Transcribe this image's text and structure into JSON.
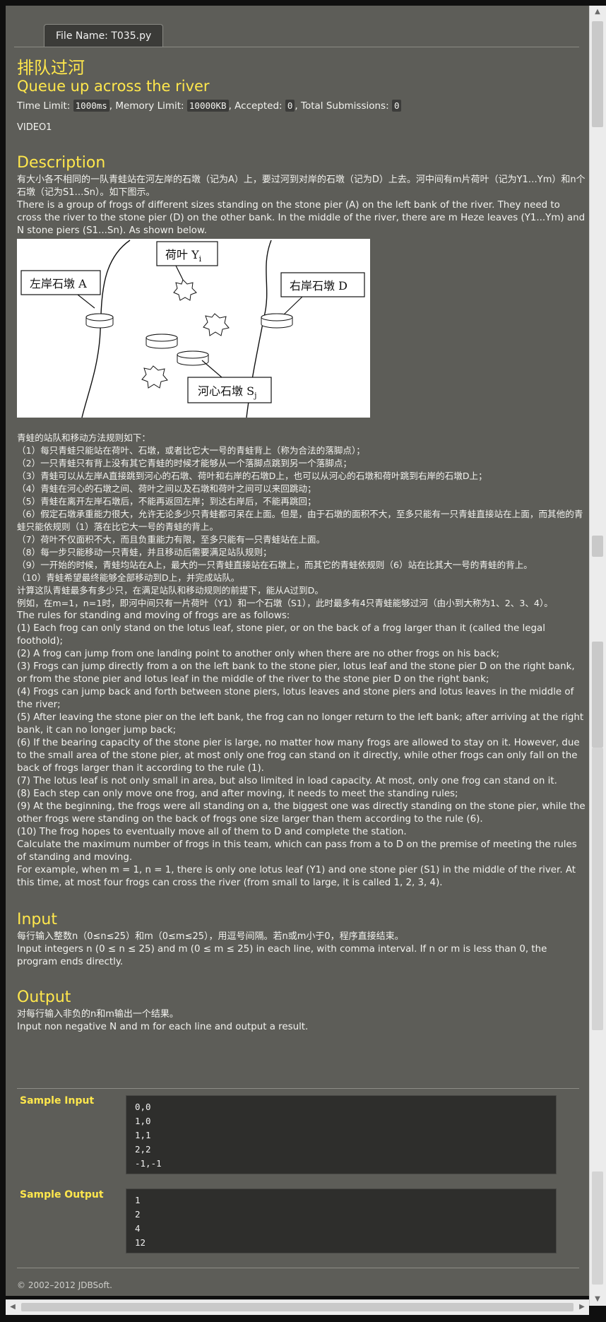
{
  "tab": {
    "file_name_label": "File Name: T035.py"
  },
  "problem": {
    "title_cn": "排队过河",
    "title_en": "Queue up across the river",
    "meta": {
      "time_limit_label": "Time Limit: ",
      "time_limit": "1000ms",
      "memory_limit_label": ", Memory Limit: ",
      "memory_limit": "10000KB",
      "accepted_label": ", Accepted: ",
      "accepted": "0",
      "total_submissions_label": ", Total Submissions: ",
      "total_submissions": "0"
    },
    "video": "VIDEO1"
  },
  "description": {
    "heading": "Description",
    "text_cn": "有大小各不相同的一队青蛙站在河左岸的石墩（记为A）上，要过河到对岸的石墩（记为D）上去。河中间有m片荷叶（记为Y1…Ym）和n个石墩（记为S1…Sn）。如下图示。",
    "text_en": "There is a group of frogs of different sizes standing on the stone pier (A) on the left bank of the river. They need to cross the river to the stone pier (D) on the other bank. In the middle of the river, there are m Heze leaves (Y1...Ym) and N stone piers (S1...Sn). As shown below.",
    "figure_labels": {
      "left_pier": "左岸石墩 A",
      "lotus": "荷叶 Y",
      "lotus_sub": "i",
      "right_pier": "右岸石墩 D",
      "middle_pier": "河心石墩 S",
      "middle_sub": "j"
    },
    "rules_cn": "青蛙的站队和移动方法规则如下：\n（1）每只青蛙只能站在荷叶、石墩，或者比它大一号的青蛙背上（称为合法的落脚点）；\n（2）一只青蛙只有背上没有其它青蛙的时候才能够从一个落脚点跳到另一个落脚点；\n（3）青蛙可以从左岸A直接跳到河心的石墩、荷叶和右岸的石墩D上，也可以从河心的石墩和荷叶跳到右岸的石墩D上；\n（4）青蛙在河心的石墩之间、荷叶之间以及石墩和荷叶之间可以来回跳动；\n（5）青蛙在离开左岸石墩后，不能再返回左岸；到达右岸后，不能再跳回；\n（6）假定石墩承重能力很大，允许无论多少只青蛙都可呆在上面。但是，由于石墩的面积不大，至多只能有一只青蛙直接站在上面，而其他的青蛙只能依规则（1）落在比它大一号的青蛙的背上。\n（7）荷叶不仅面积不大，而且负重能力有限，至多只能有一只青蛙站在上面。\n（8）每一步只能移动一只青蛙，并且移动后需要满足站队规则；\n（9）一开始的时候，青蛙均站在A上，最大的一只青蛙直接站在石墩上，而其它的青蛙依规则（6）站在比其大一号的青蛙的背上。\n（10）青蛙希望最终能够全部移动到D上，并完成站队。\n计算这队青蛙最多有多少只，在满足站队和移动规则的前提下，能从A过到D。\n例如，在m=1，n=1时，即河中间只有一片荷叶（Y1）和一个石墩（S1），此时最多有4只青蛙能够过河（由小到大称为1、2、3、4）。",
    "rules_en": "The rules for standing and moving of frogs are as follows:\n(1) Each frog can only stand on the lotus leaf, stone pier, or on the back of a frog larger than it (called the legal foothold);\n(2) A frog can jump from one landing point to another only when there are no other frogs on his back;\n(3) Frogs can jump directly from a on the left bank to the stone pier, lotus leaf and the stone pier D on the right bank, or from the stone pier and lotus leaf in the middle of the river to the stone pier D on the right bank;\n(4) Frogs can jump back and forth between stone piers, lotus leaves and stone piers and lotus leaves in the middle of the river;\n(5) After leaving the stone pier on the left bank, the frog can no longer return to the left bank; after arriving at the right bank, it can no longer jump back;\n(6) If the bearing capacity of the stone pier is large, no matter how many frogs are allowed to stay on it. However, due to the small area of the stone pier, at most only one frog can stand on it directly, while other frogs can only fall on the back of frogs larger than it according to the rule (1).\n(7) The lotus leaf is not only small in area, but also limited in load capacity. At most, only one frog can stand on it.\n(8) Each step can only move one frog, and after moving, it needs to meet the standing rules;\n(9) At the beginning, the frogs were all standing on a, the biggest one was directly standing on the stone pier, while the other frogs were standing on the back of frogs one size larger than them according to the rule (6).\n(10) The frog hopes to eventually move all of them to D and complete the station.\nCalculate the maximum number of frogs in this team, which can pass from a to D on the premise of meeting the rules of standing and moving.\nFor example, when m = 1, n = 1, there is only one lotus leaf (Y1) and one stone pier (S1) in the middle of the river. At this time, at most four frogs can cross the river (from small to large, it is called 1, 2, 3, 4)."
  },
  "input_section": {
    "heading": "Input",
    "text_cn": "每行输入整数n（0≤n≤25）和m（0≤m≤25），用逗号间隔。若n或m小于0，程序直接结束。",
    "text_en": "Input integers n (0 ≤ n ≤ 25) and m (0 ≤ m ≤ 25) in each line, with comma interval. If n or m is less than 0, the program ends directly."
  },
  "output_section": {
    "heading": "Output",
    "text_cn": "对每行输入非负的n和m输出一个结果。",
    "text_en": "Input non negative N and m for each line and output a result."
  },
  "samples": {
    "input_label": "Sample Input",
    "input_text": "0,0\n1,0\n1,1\n2,2\n-1,-1",
    "output_label": "Sample Output",
    "output_text": "1\n2\n4\n12"
  },
  "footer": {
    "copyright": "© 2002–2012  JDBSoft."
  },
  "colors": {
    "page_bg": "#5d5d58",
    "accent": "#ffe74c",
    "code_bg": "#2e2e2c"
  }
}
